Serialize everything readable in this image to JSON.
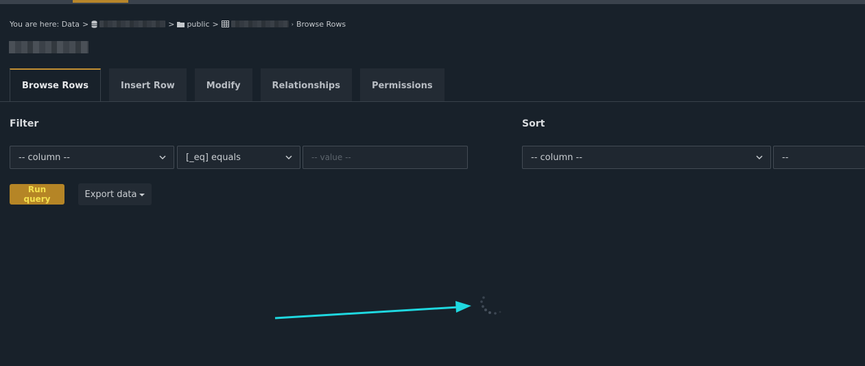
{
  "breadcrumb": {
    "prefix": "You are here: Data",
    "schema": "public",
    "current": "Browse Rows",
    "separator": ">"
  },
  "tabs": [
    {
      "label": "Browse Rows",
      "active": true
    },
    {
      "label": "Insert Row",
      "active": false
    },
    {
      "label": "Modify",
      "active": false
    },
    {
      "label": "Relationships",
      "active": false
    },
    {
      "label": "Permissions",
      "active": false
    }
  ],
  "filter": {
    "label": "Filter",
    "column_value": "-- column --",
    "operator_value": "[_eq] equals",
    "value_placeholder": "-- value --"
  },
  "sort": {
    "label": "Sort",
    "column_value": "-- column --",
    "order_value": "--"
  },
  "actions": {
    "run_query_label": "Run query",
    "export_label": "Export data"
  },
  "status": {
    "loading": true
  },
  "colors": {
    "accent": "#b58526",
    "run_query_text": "#f4e04d",
    "annotation_arrow": "#1fd8e0",
    "background": "#18212a"
  },
  "icons": [
    "database-icon",
    "folder-icon",
    "table-icon",
    "chevron-down-icon",
    "caret-down-icon",
    "spinner-icon"
  ]
}
